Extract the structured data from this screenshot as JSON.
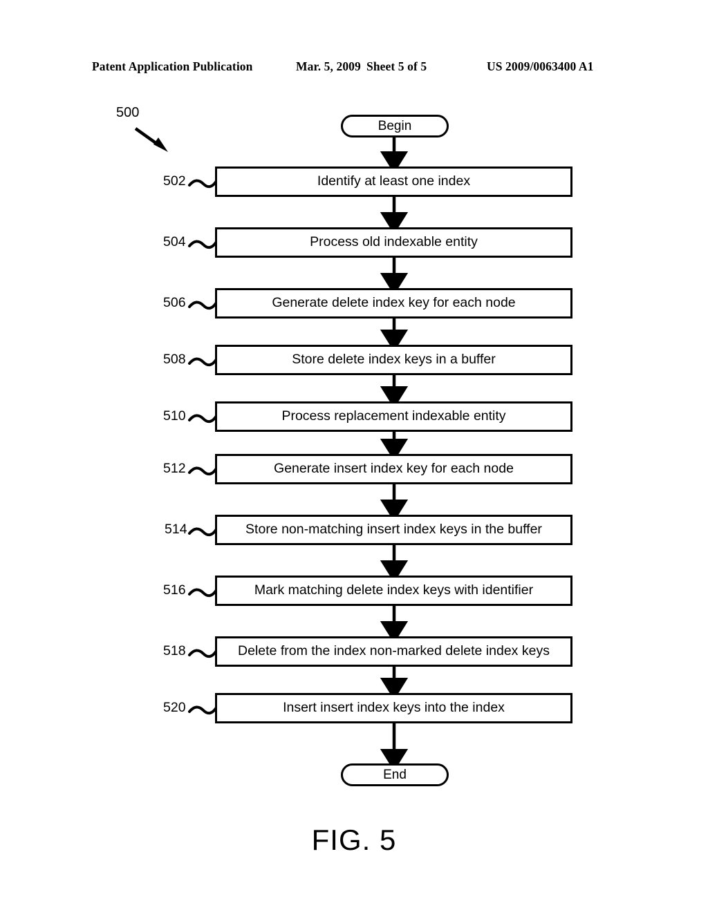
{
  "header": {
    "publication": "Patent Application Publication",
    "date": "Mar. 5, 2009",
    "sheet": "Sheet 5 of 5",
    "patent_number": "US 2009/0063400 A1"
  },
  "figure": {
    "caption": "FIG. 5",
    "diagram_reference": "500"
  },
  "flowchart": {
    "type": "flowchart",
    "orientation": "vertical",
    "start": {
      "ref": "",
      "label": "Begin",
      "shape": "terminal"
    },
    "end": {
      "ref": "",
      "label": "End",
      "shape": "terminal"
    },
    "steps": [
      {
        "ref": "502",
        "label": "Identify at least one index"
      },
      {
        "ref": "504",
        "label": "Process old indexable entity"
      },
      {
        "ref": "506",
        "label": "Generate delete index key for each node"
      },
      {
        "ref": "508",
        "label": "Store delete index keys in a buffer"
      },
      {
        "ref": "510",
        "label": "Process replacement indexable entity"
      },
      {
        "ref": "512",
        "label": "Generate insert index key for each node"
      },
      {
        "ref": "514",
        "label": "Store non-matching insert index keys in the buffer"
      },
      {
        "ref": "516",
        "label": "Mark matching delete index keys with identifier"
      },
      {
        "ref": "518",
        "label": "Delete from the index non-marked delete index keys"
      },
      {
        "ref": "520",
        "label": "Insert insert index keys into the index"
      }
    ]
  },
  "colors": {
    "ink": "#000000",
    "paper": "#ffffff"
  }
}
